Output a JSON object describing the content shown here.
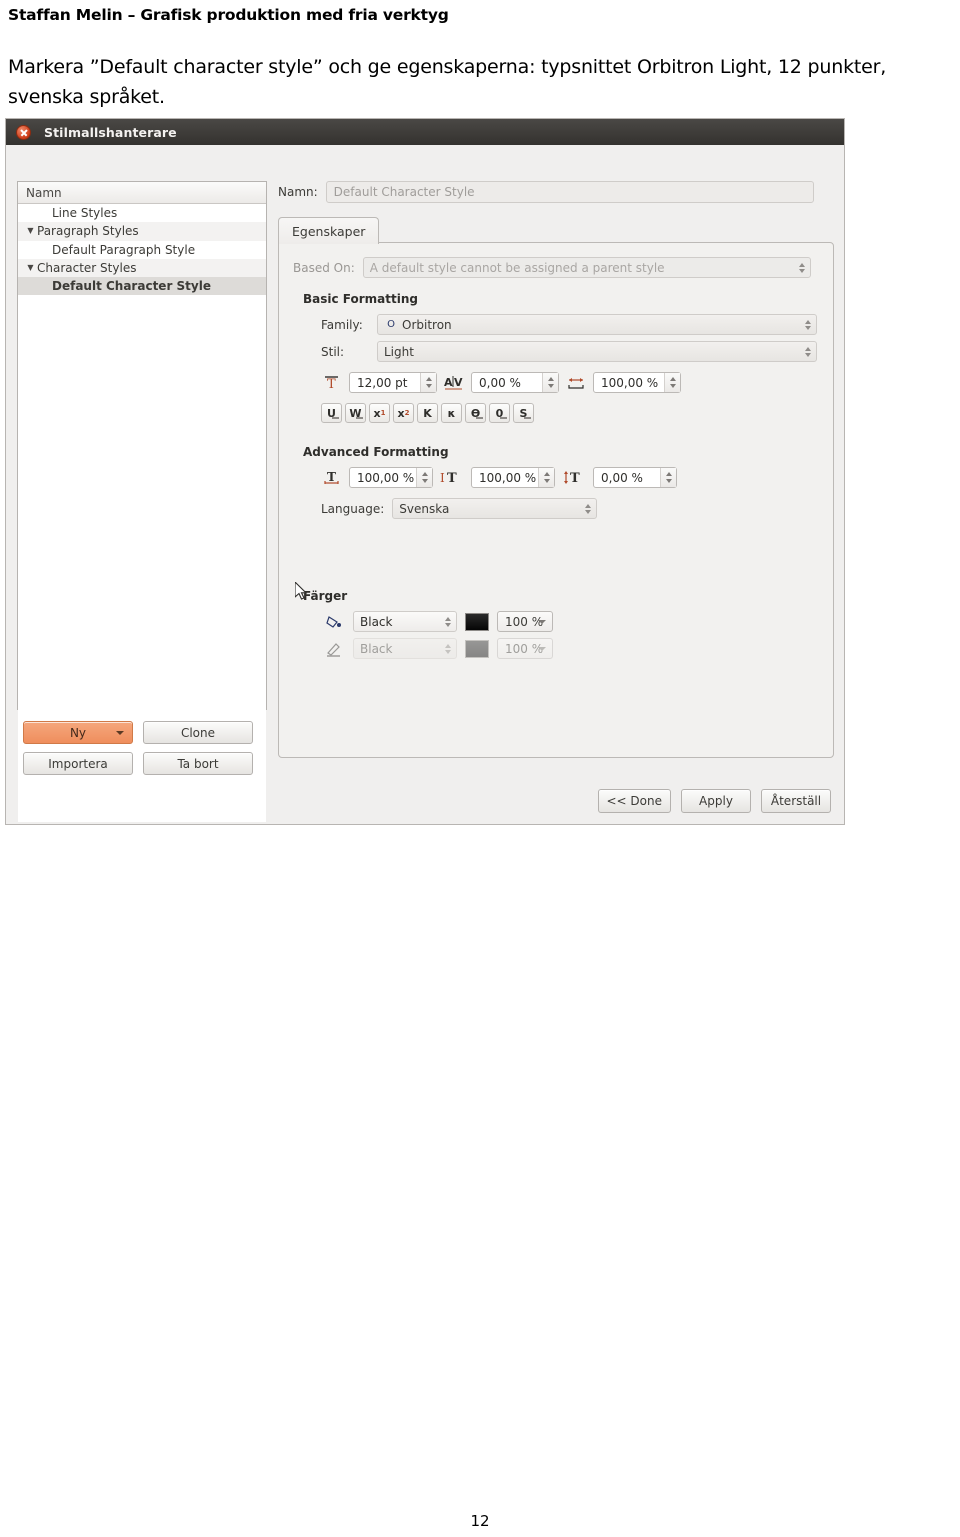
{
  "document": {
    "header": "Staffan Melin – Grafisk produktion med fria verktyg",
    "body": "Markera ”Default character style” och ge egenskaperna: typsnittet Orbitron Light, 12 punkter, svenska språket.",
    "page_number": "12"
  },
  "dialog": {
    "title": "Stilmallshanterare",
    "close_icon": "close-icon",
    "tree": {
      "column_header": "Namn",
      "rows": [
        {
          "label": "Line Styles",
          "indent": 1,
          "expander": "",
          "selected": false
        },
        {
          "label": "Paragraph Styles",
          "indent": 0,
          "expander": "▼",
          "selected": false
        },
        {
          "label": "Default Paragraph Style",
          "indent": 1,
          "expander": "",
          "selected": false
        },
        {
          "label": "Character Styles",
          "indent": 0,
          "expander": "▼",
          "selected": false
        },
        {
          "label": "Default Character Style",
          "indent": 1,
          "expander": "",
          "selected": true
        }
      ]
    },
    "tree_buttons": {
      "new": "Ny",
      "clone": "Clone",
      "import": "Importera",
      "delete": "Ta bort"
    },
    "name_label": "Namn:",
    "name_value": "Default Character Style",
    "tab_label": "Egenskaper",
    "based_on_label": "Based On:",
    "based_on_value": "A default style cannot be assigned a parent style",
    "basic_formatting": {
      "title": "Basic Formatting",
      "family_label": "Family:",
      "family_value": "Orbitron",
      "family_preview_glyph": "O",
      "style_label": "Stil:",
      "style_value": "Light",
      "font_size_icon": "font-size-icon",
      "font_size_value": "12,00 pt",
      "tracking_icon": "tracking-icon",
      "tracking_value": "0,00 %",
      "width_icon": "glyph-width-icon",
      "width_value": "100,00 %",
      "toggles": [
        {
          "name": "underline-toggle",
          "glyph": "U"
        },
        {
          "name": "underline-words-toggle",
          "glyph": "W"
        },
        {
          "name": "subscript-toggle",
          "glyph": "x",
          "affix": "sub",
          "affix_char": "1"
        },
        {
          "name": "superscript-toggle",
          "glyph": "x",
          "affix": "sup",
          "affix_char": "2"
        },
        {
          "name": "allcaps-toggle",
          "glyph": "K"
        },
        {
          "name": "smallcaps-toggle",
          "glyph": "κ"
        },
        {
          "name": "strikethrough-toggle",
          "glyph": "Ө"
        },
        {
          "name": "outline-toggle",
          "glyph": "0"
        },
        {
          "name": "shadow-toggle",
          "glyph": "S"
        }
      ]
    },
    "advanced_formatting": {
      "title": "Advanced Formatting",
      "baseline_icon": "baseline-offset-icon",
      "baseline_value": "100,00 %",
      "scale_h_icon": "horizontal-scale-icon",
      "scale_h_value": "100,00 %",
      "scale_v_icon": "vertical-scale-icon",
      "scale_v_value": "0,00 %",
      "language_label": "Language:",
      "language_value": "Svenska"
    },
    "colors": {
      "title": "Färger",
      "fill_icon": "fill-color-icon",
      "fill_value": "Black",
      "fill_shade": "100 %",
      "stroke_icon": "stroke-color-icon",
      "stroke_value": "Black",
      "stroke_shade": "100 %"
    },
    "actions": {
      "done": "<< Done",
      "apply": "Apply",
      "reset": "Återställ"
    }
  }
}
